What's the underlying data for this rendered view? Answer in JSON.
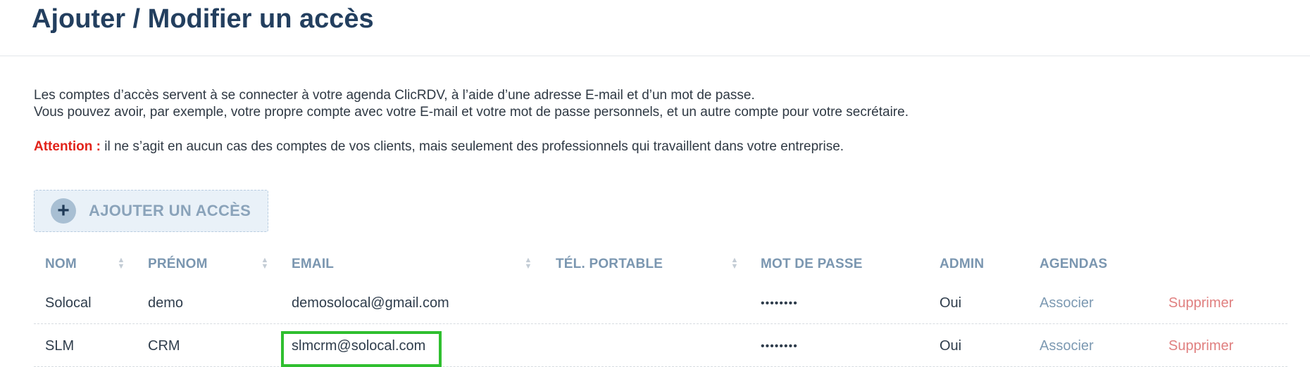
{
  "page": {
    "title": "Ajouter / Modifier un accès"
  },
  "intro": {
    "line1": "Les comptes d’accès servent à se connecter à votre agenda ClicRDV, à l’aide d’une adresse E-mail et d’un mot de passe.",
    "line2": "Vous pouvez avoir, par exemple, votre propre compte avec votre E-mail et votre mot de passe personnels, et un autre compte pour votre secrétaire.",
    "attention_label": "Attention :",
    "attention_text": " il ne s’agit en aucun cas des comptes de vos clients, mais seulement des professionnels qui travaillent dans votre entreprise."
  },
  "add_button": {
    "icon": "plus-circle-icon",
    "label": "AJOUTER UN ACCÈS"
  },
  "table": {
    "headers": {
      "nom": "NOM",
      "prenom": "PRÉNOM",
      "email": "EMAIL",
      "tel": "TÉL. PORTABLE",
      "password": "MOT DE PASSE",
      "admin": "ADMIN",
      "agendas": "AGENDAS"
    },
    "rows": [
      {
        "nom": "Solocal",
        "prenom": "demo",
        "email": "demosolocal@gmail.com",
        "tel": "",
        "password": "••••••••",
        "admin": "Oui",
        "associate": "Associer",
        "delete": "Supprimer"
      },
      {
        "nom": "SLM",
        "prenom": "CRM",
        "email": "slmcrm@solocal.com",
        "tel": "",
        "password": "••••••••",
        "admin": "Oui",
        "associate": "Associer",
        "delete": "Supprimer"
      }
    ]
  },
  "colors": {
    "title": "#233f5f",
    "attention": "#e2231a",
    "header": "#7a96b0",
    "link": "#7c99b2",
    "delete": "#e08080",
    "highlight": "#2fbf2f"
  }
}
